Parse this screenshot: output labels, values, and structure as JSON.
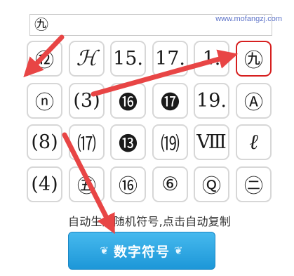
{
  "input": {
    "value": "㊈"
  },
  "watermark": "www.mofangzj.com",
  "grid": [
    {
      "symbol": "⑫",
      "style": "normal",
      "selected": false
    },
    {
      "symbol": "ℋ",
      "style": "script",
      "selected": false
    },
    {
      "symbol": "15.",
      "style": "normal",
      "selected": false
    },
    {
      "symbol": "17.",
      "style": "normal",
      "selected": false
    },
    {
      "symbol": "1.",
      "style": "normal",
      "selected": false
    },
    {
      "symbol": "㊈",
      "style": "normal",
      "selected": true
    },
    {
      "symbol": "ⓝ",
      "style": "normal",
      "selected": false
    },
    {
      "symbol": "(3)",
      "style": "normal",
      "selected": false
    },
    {
      "symbol": "⓰",
      "style": "normal",
      "selected": false
    },
    {
      "symbol": "⓱",
      "style": "normal",
      "selected": false
    },
    {
      "symbol": "19.",
      "style": "normal",
      "selected": false
    },
    {
      "symbol": "Ⓐ",
      "style": "normal",
      "selected": false
    },
    {
      "symbol": "(8)",
      "style": "normal",
      "selected": false
    },
    {
      "symbol": "⒄",
      "style": "normal",
      "selected": false
    },
    {
      "symbol": "⓭",
      "style": "normal",
      "selected": false
    },
    {
      "symbol": "⒆",
      "style": "normal",
      "selected": false
    },
    {
      "symbol": "Ⅷ",
      "style": "normal",
      "selected": false
    },
    {
      "symbol": "ℓ",
      "style": "script",
      "selected": false
    },
    {
      "symbol": "(4)",
      "style": "normal",
      "selected": false
    },
    {
      "symbol": "㊄",
      "style": "normal",
      "selected": false
    },
    {
      "symbol": "⑯",
      "style": "normal",
      "selected": false
    },
    {
      "symbol": "⑥",
      "style": "normal",
      "selected": false
    },
    {
      "symbol": "Ⓠ",
      "style": "normal",
      "selected": false
    },
    {
      "symbol": "㊁",
      "style": "normal",
      "selected": false
    }
  ],
  "caption": "自动生成随机符号,点击自动复制",
  "button": {
    "label": "数字符号",
    "accent": "#1d97d8"
  },
  "annotation_color": "#e84545"
}
